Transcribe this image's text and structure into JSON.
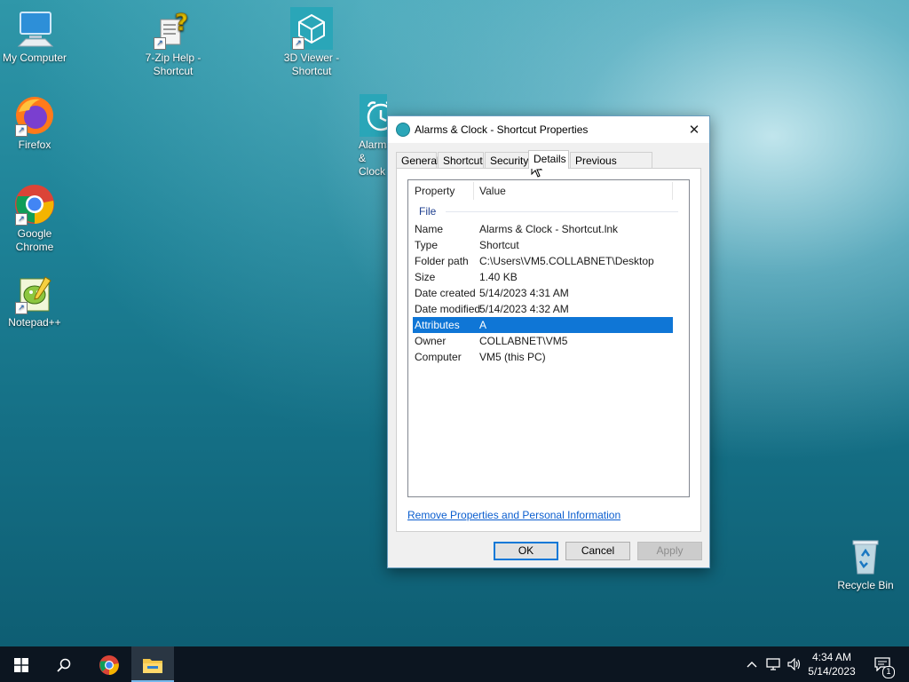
{
  "desktop": {
    "icons": [
      {
        "label": "My Computer",
        "icon": "computer-icon"
      },
      {
        "label": "7-Zip Help - Shortcut",
        "icon": "help-file-icon"
      },
      {
        "label": "3D Viewer - Shortcut",
        "icon": "cube-icon"
      },
      {
        "label": "Firefox",
        "icon": "firefox-icon"
      },
      {
        "label": "Google Chrome",
        "icon": "chrome-icon"
      },
      {
        "label": "Notepad++",
        "icon": "notepad-plus-icon"
      },
      {
        "label": "Alarms & Clock",
        "icon": "alarm-clock-icon"
      },
      {
        "label": "Recycle Bin",
        "icon": "recycle-bin-icon"
      }
    ]
  },
  "dialog": {
    "title": "Alarms & Clock - Shortcut Properties",
    "close_glyph": "✕",
    "tabs": [
      "General",
      "Shortcut",
      "Security",
      "Details",
      "Previous Versions"
    ],
    "active_tab": "Details",
    "columns": {
      "property": "Property",
      "value": "Value"
    },
    "group": "File",
    "rows": [
      {
        "property": "Name",
        "value": "Alarms & Clock - Shortcut.lnk"
      },
      {
        "property": "Type",
        "value": "Shortcut"
      },
      {
        "property": "Folder path",
        "value": "C:\\Users\\VM5.COLLABNET\\Desktop"
      },
      {
        "property": "Size",
        "value": "1.40 KB"
      },
      {
        "property": "Date created",
        "value": "5/14/2023 4:31 AM"
      },
      {
        "property": "Date modified",
        "value": "5/14/2023 4:32 AM"
      },
      {
        "property": "Attributes",
        "value": "A"
      },
      {
        "property": "Owner",
        "value": "COLLABNET\\VM5"
      },
      {
        "property": "Computer",
        "value": "VM5 (this PC)"
      }
    ],
    "selected_row": "Attributes",
    "link": "Remove Properties and Personal Information",
    "buttons": {
      "ok": "OK",
      "cancel": "Cancel",
      "apply": "Apply"
    }
  },
  "taskbar": {
    "time": "4:34 AM",
    "date": "5/14/2023",
    "notification_count": "1"
  },
  "colors": {
    "selection": "#0f76d6",
    "link": "#0b5ecf",
    "taskbar": "#0c1520"
  }
}
